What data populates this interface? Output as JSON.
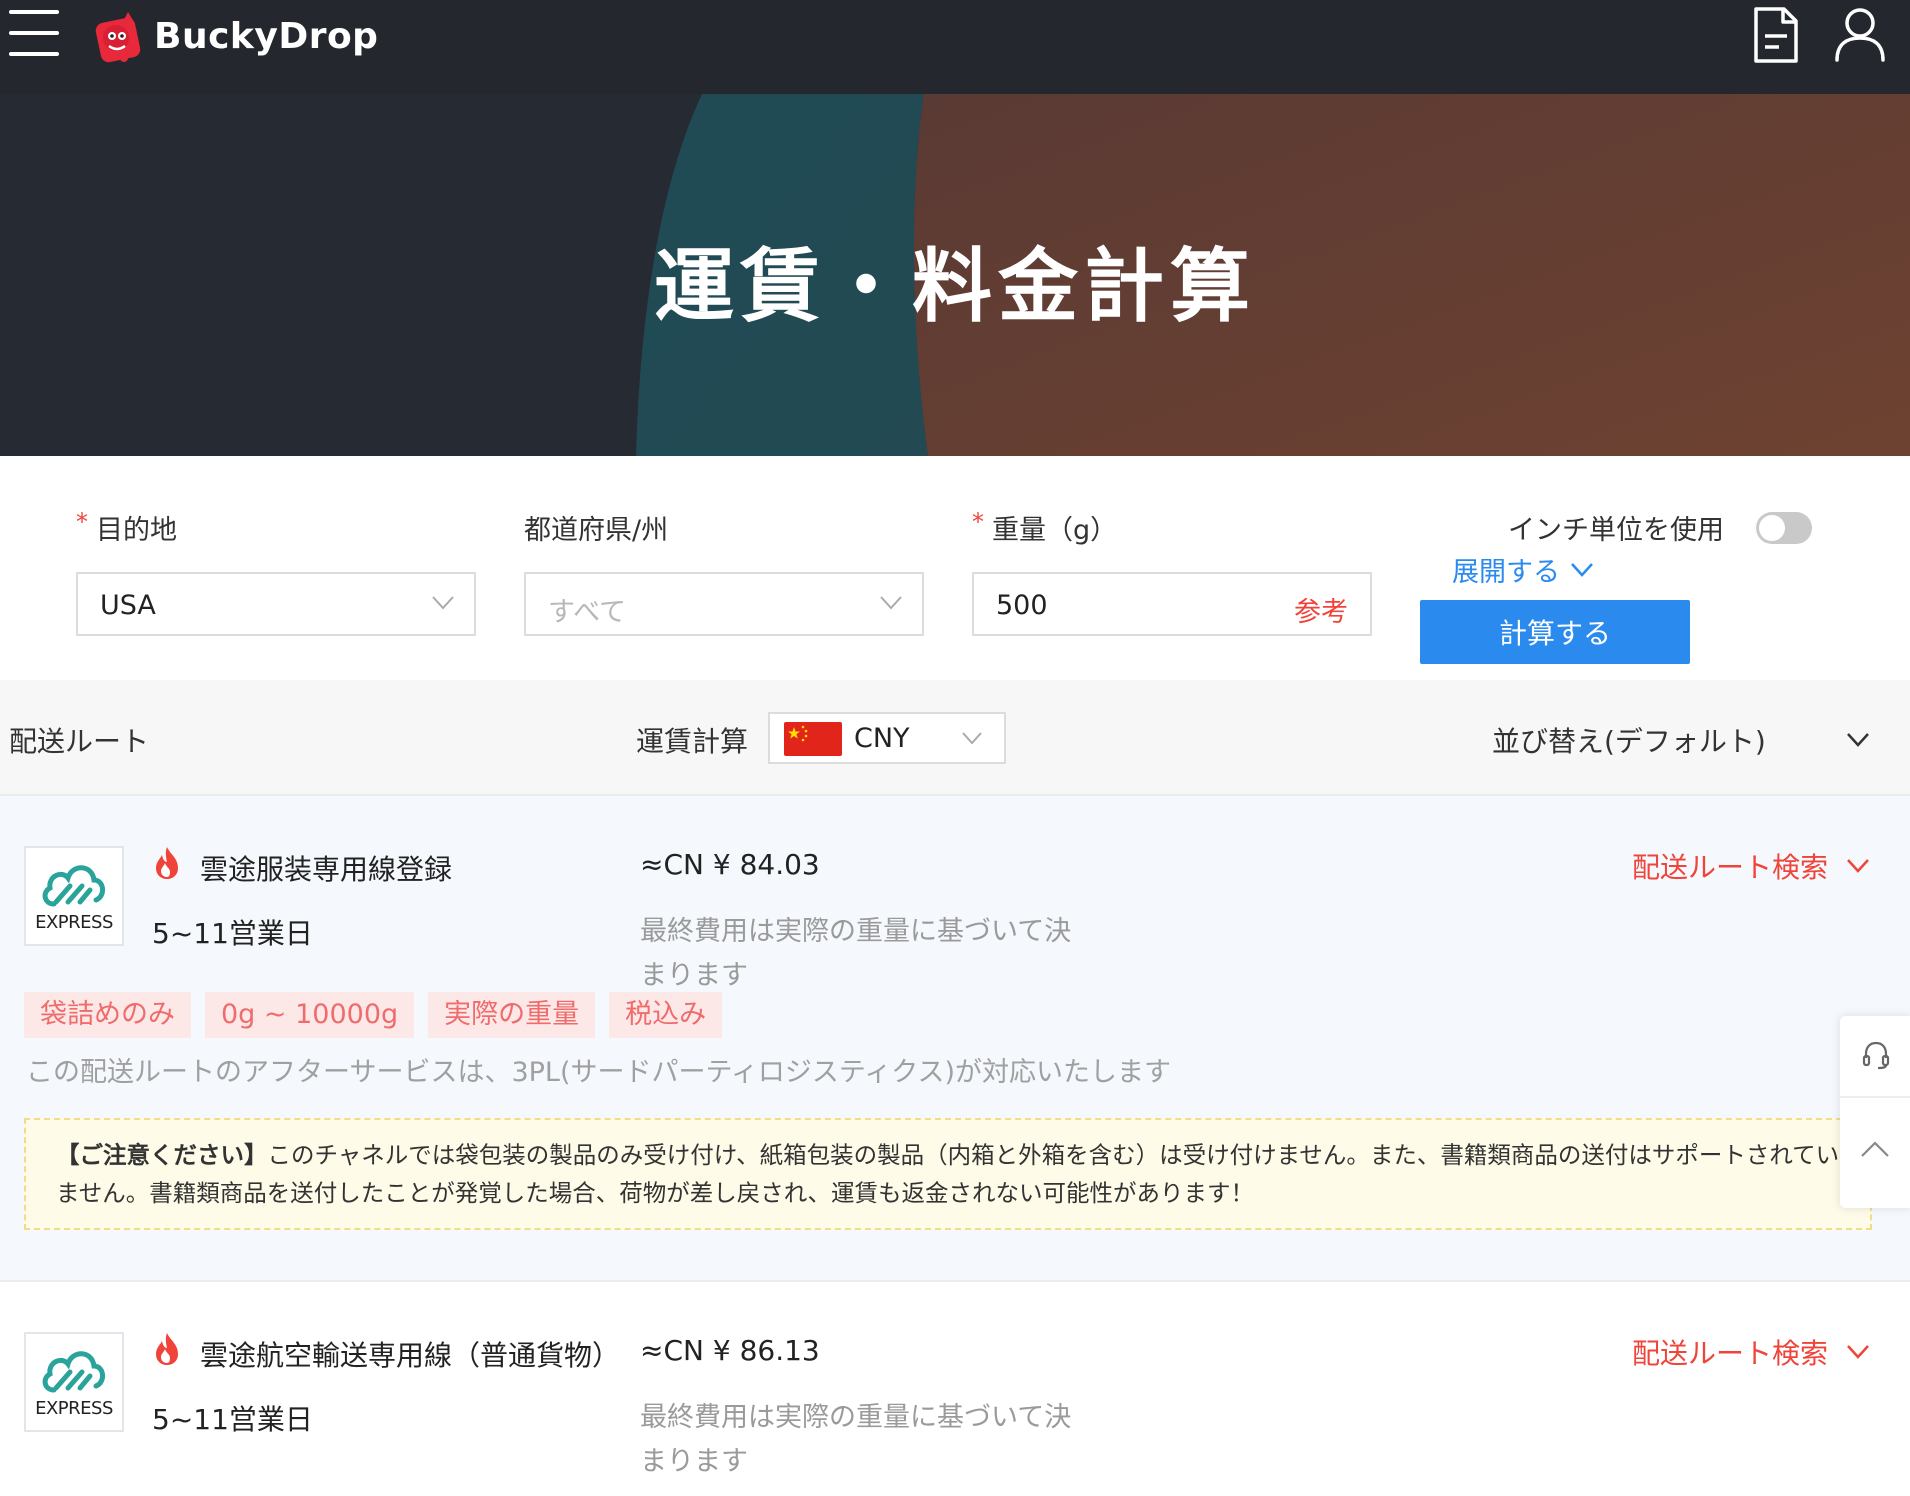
{
  "header": {
    "logo_text": "BuckyDrop"
  },
  "hero": {
    "title": "運賃・料金計算"
  },
  "form": {
    "destination_label": "目的地",
    "destination_value": "USA",
    "state_label": "都道府県/州",
    "state_placeholder": "すべて",
    "weight_label": "重量（g）",
    "weight_value": "500",
    "weight_reference": "参考",
    "inch_label": "インチ単位を使用",
    "inch_toggle_on": false,
    "expand_label": "展開する",
    "calculate_label": "計算する",
    "required_mark": "*"
  },
  "filter": {
    "route_label": "配送ルート",
    "freight_label": "運賃計算",
    "currency_value": "CNY",
    "sort_label": "並び替え(デフォルト)"
  },
  "routes": [
    {
      "logo_text": "EXPRESS",
      "name": "雲途服装専用線登録",
      "days": "5~11営業日",
      "price": "≈CN ¥ 84.03",
      "note": "最終費用は実際の重量に基づいて決まります",
      "search_label": "配送ルート検索",
      "tags": [
        "袋詰めのみ",
        "0g ~ 10000g",
        "実際の重量",
        "税込み"
      ],
      "after_service": "この配送ルートのアフターサービスは、3PL(サードパーティロジスティクス)が対応いたします",
      "notice_title": "【ご注意ください】",
      "notice_body": "このチャネルでは袋包装の製品のみ受け付け、紙箱包装の製品（内箱と外箱を含む）は受け付けません。また、書籍類商品の送付はサポートされていません。書籍類商品を送付したことが発覚した場合、荷物が差し戻され、運賃も返金されない可能性があります！"
    },
    {
      "logo_text": "EXPRESS",
      "name": "雲途航空輸送専用線（普通貨物）",
      "days": "5~11営業日",
      "price": "≈CN ¥ 86.13",
      "note": "最終費用は実際の重量に基づいて決まります",
      "search_label": "配送ルート検索"
    }
  ],
  "colors": {
    "topbar": "#24272e",
    "accent_blue": "#2b8aee",
    "accent_red": "#f0443a",
    "tag_bg": "#fde8e8",
    "notice_bg": "#fffbe9"
  },
  "icons": {
    "menu": "hamburger-icon",
    "orders": "document-icon",
    "account": "user-icon",
    "hot": "fire-icon",
    "support": "headset-icon",
    "back_to_top": "chevron-up-icon"
  }
}
